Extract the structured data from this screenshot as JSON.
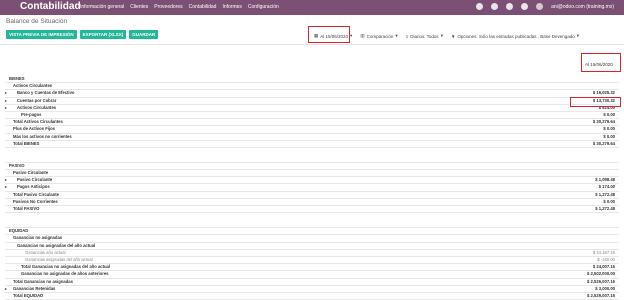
{
  "topbar": {
    "app_name": "Contabilidad",
    "menu": [
      "Información general",
      "Clientes",
      "Proveedores",
      "Contabilidad",
      "Informes",
      "Configuración"
    ],
    "user": "ani@odoo.com (training.mx)"
  },
  "breadcrumb": "Balance de Situación",
  "buttons": {
    "print": "VISTA PREVIA DE IMPRESIÓN",
    "export": "EXPORTAR (XLSX)",
    "save": "GUARDAR"
  },
  "filters": {
    "date": "Al 15/06/2020",
    "comparison": "Comparación",
    "journals": "Diarios: Todos",
    "options": "Opciones: Sólo las entradas publicadas , Base Devengado"
  },
  "column_header": "Al 15/06/2020",
  "rows": [
    {
      "label": "BIENES",
      "value": "",
      "indent": 0,
      "bold": true,
      "caret": false
    },
    {
      "label": "Activos Circulantes",
      "value": "",
      "indent": 1,
      "bold": true,
      "caret": false
    },
    {
      "label": "Banco y Cuentas de Efectivo",
      "value": "$ 16,025.32",
      "indent": 2,
      "bold": true,
      "caret": true
    },
    {
      "label": "Cuentas por Cobrar",
      "value": "$ 13,730.32",
      "indent": 2,
      "bold": true,
      "caret": true
    },
    {
      "label": "Activos Circulantes",
      "value": "$ 524.00",
      "indent": 2,
      "bold": true,
      "caret": true
    },
    {
      "label": "Pre-pagos",
      "value": "$ 0.00",
      "indent": 3,
      "bold": true,
      "caret": false
    },
    {
      "label": "Total Activos Circulantes",
      "value": "$ 30,279.64",
      "indent": 1,
      "bold": true,
      "caret": false
    },
    {
      "label": "Plus de Activos Fijos",
      "value": "$ 0.00",
      "indent": 1,
      "bold": true,
      "caret": false
    },
    {
      "label": "Más los activos no corrientes",
      "value": "$ 0.00",
      "indent": 1,
      "bold": true,
      "caret": false
    },
    {
      "label": "Total BIENES",
      "value": "$ 30,279.64",
      "indent": 1,
      "bold": true,
      "caret": false
    },
    {
      "gap": true
    },
    {
      "label": "PASIVO",
      "value": "",
      "indent": 0,
      "bold": true,
      "caret": false
    },
    {
      "label": "Pasivo Circulante",
      "value": "",
      "indent": 1,
      "bold": true,
      "caret": false
    },
    {
      "label": "Pasivo Circulante",
      "value": "$ 1,098.48",
      "indent": 2,
      "bold": true,
      "caret": true
    },
    {
      "label": "Pagos Anticipos",
      "value": "$ 174.00",
      "indent": 2,
      "bold": true,
      "caret": true
    },
    {
      "label": "Total Pasivo Circulante",
      "value": "$ 1,272.48",
      "indent": 1,
      "bold": true,
      "caret": false
    },
    {
      "label": "Pasivos No Corrientes",
      "value": "$ 0.00",
      "indent": 1,
      "bold": true,
      "caret": false
    },
    {
      "label": "Total PASIVO",
      "value": "$ 1,272.48",
      "indent": 1,
      "bold": true,
      "caret": false
    },
    {
      "gap": true
    },
    {
      "label": "EQUIDAD",
      "value": "",
      "indent": 0,
      "bold": true,
      "caret": false
    },
    {
      "label": "Ganancias no asignadas",
      "value": "",
      "indent": 1,
      "bold": true,
      "caret": false
    },
    {
      "label": "Ganancias no asignadas del año actual",
      "value": "",
      "indent": 2,
      "bold": true,
      "caret": false
    },
    {
      "label": "Ganancias año actual",
      "value": "$ 24,167.16",
      "indent": 4,
      "bold": false,
      "caret": false,
      "muted": true
    },
    {
      "label": "Ganancias asignadas del año actual",
      "value": "$ -160.00",
      "indent": 4,
      "bold": false,
      "caret": false,
      "muted": true
    },
    {
      "label": "Total Ganancias no asignadas del año actual",
      "value": "$ 24,007.16",
      "indent": 3,
      "bold": true,
      "caret": false
    },
    {
      "label": "Ganancias no asignadas de años anteriores",
      "value": "$ 2,502,000.00",
      "indent": 3,
      "bold": true,
      "caret": false
    },
    {
      "label": "Total Ganancias no asignadas",
      "value": "$ 2,526,007.16",
      "indent": 1,
      "bold": true,
      "caret": false
    },
    {
      "label": "Ganancias Retenidas",
      "value": "$ 3,000.00",
      "indent": 1,
      "bold": true,
      "caret": true
    },
    {
      "label": "Total EQUIDAD",
      "value": "$ 2,529,007.16",
      "indent": 1,
      "bold": true,
      "caret": false
    }
  ]
}
